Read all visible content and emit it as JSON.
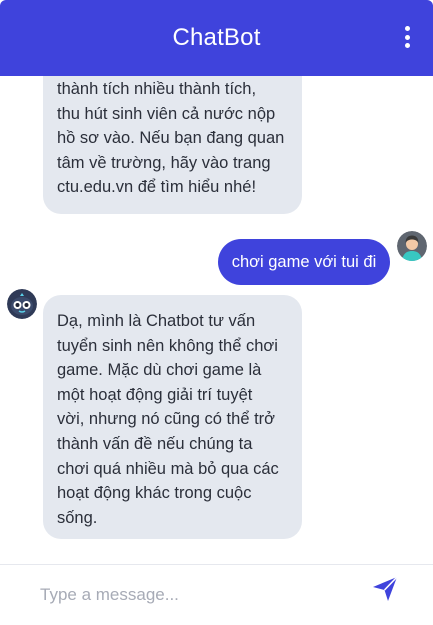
{
  "header": {
    "title": "ChatBot",
    "menu_icon": "more-vertical-icon"
  },
  "colors": {
    "primary": "#3f43dc",
    "bot_bubble": "#e4e8ef",
    "user_text": "#ffffff",
    "bot_text": "#2b2f3a"
  },
  "messages": [
    {
      "sender": "bot",
      "text": "thành tích nhiều thành tích,\nthu hút sinh viên cả nước nộp\nhồ sơ vào. Nếu bạn đang quan\ntâm về trường, hãy vào trang\nctu.edu.vn để tìm hiểu nhé!"
    },
    {
      "sender": "user",
      "text": "chơi game với tui đi"
    },
    {
      "sender": "bot",
      "text": "Dạ, mình là Chatbot tư vấn\ntuyển sinh nên không thể chơi\ngame. Mặc dù chơi game là\nmột hoạt động giải trí tuyệt\nvời, nhưng nó cũng có thể trở\nthành vấn đề nếu chúng ta\nchơi quá nhiều mà bỏ qua các\nhoạt động khác trong cuộc\nsống."
    }
  ],
  "composer": {
    "placeholder": "Type a message...",
    "value": "",
    "send_icon": "send-icon"
  }
}
